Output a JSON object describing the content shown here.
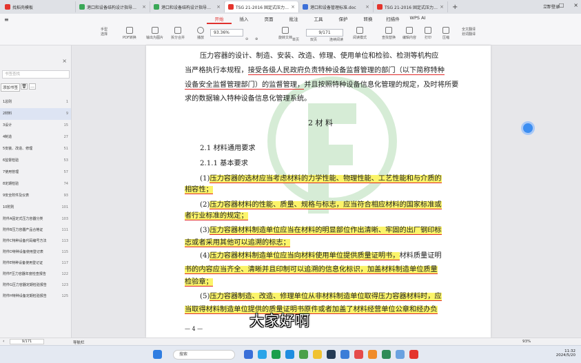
{
  "tabs": [
    {
      "title": "找稻壳模板",
      "color": "#e4352d"
    },
    {
      "title": "港口和设备结构设计指导书2020",
      "color": "#3aa857"
    },
    {
      "title": "港口和设备结构设计指导书2020",
      "color": "#3aa857"
    },
    {
      "title": "TSG 21-2016 固定式压力容器安全",
      "color": "#e4352d"
    },
    {
      "title": "港口和设备管理标准.doc",
      "color": "#3b6fd8"
    },
    {
      "title": "TSG 21-2016 固定式压力容器安全",
      "color": "#e4352d"
    }
  ],
  "login_label": "立即登录",
  "menus": [
    "开始",
    "插入",
    "页面",
    "批注",
    "工具",
    "保护",
    "转换",
    "扫描件",
    "WPS AI"
  ],
  "active_menu": "开始",
  "toolbar": {
    "hand": "手型",
    "select": "选择",
    "pdf_convert": "PDF转换",
    "pdf_to_img": "输出为图片",
    "split_merge": "拆分合并",
    "play": "播放",
    "zoom": "93.36%",
    "rotate": "旋转文档",
    "page": "9/171",
    "single": "单页",
    "double": "双页",
    "continuous": "连续阅读",
    "read_mode": "阅读模式",
    "find": "查找替换",
    "edit": "编辑内容",
    "print": "打印",
    "compress": "压缩",
    "full_translate": "全文翻译",
    "select_translate": "划词翻译"
  },
  "sidebar": {
    "search_placeholder": "书签查找",
    "add_label": "添加书签",
    "items": [
      {
        "label": "1总则",
        "page": "1"
      },
      {
        "label": "2材料",
        "page": "9"
      },
      {
        "label": "3设计",
        "page": "15"
      },
      {
        "label": "4制造",
        "page": "27"
      },
      {
        "label": "5安装、改造、修理",
        "page": "51"
      },
      {
        "label": "6监督检验",
        "page": "53"
      },
      {
        "label": "7使用管理",
        "page": "57"
      },
      {
        "label": "8定期检验",
        "page": "74"
      },
      {
        "label": "9安全附件及仪表",
        "page": "93"
      },
      {
        "label": "10附则",
        "page": "101"
      },
      {
        "label": "附件A固定式压力容器分类",
        "page": "103"
      },
      {
        "label": "附件B压力容器产品合格证",
        "page": "111"
      },
      {
        "label": "附件C特种设备代码编号方法",
        "page": "113"
      },
      {
        "label": "附件D特种设备使用登记表",
        "page": "115"
      },
      {
        "label": "附件E特种设备使用登记证",
        "page": "117"
      },
      {
        "label": "附件F压力容器年度检查报告",
        "page": "122"
      },
      {
        "label": "附件G压力容器定期检验报告",
        "page": "123"
      },
      {
        "label": "附件H特种设备定期检验报告",
        "page": "125"
      }
    ],
    "page_input": "9/171"
  },
  "doc": {
    "l1": "压力容器的设计、制造、安装、改造、修理、使用单位和检验、检测等机构应",
    "l2a": "当严格执行本规程，",
    "l2b": "接受各级人民政府负责特种设备监督管理的部门（以下简称特种",
    "l3a": "设备安全监督管理部门）的监督管理，",
    "l3b": "并且按照特种设备信息化管理的规定，及时将所要",
    "l4": "求的数据输入特种设备信息化管理系统。",
    "h2": "2  材    料",
    "s21": "2.1  材料通用要求",
    "s211": "2.1.1  基本要求",
    "p1a": "(1)",
    "p1b": "压力容器的选材应当考虑材料的力学性能、物理性能、工艺性能和与介质的",
    "p1c": "相容性；",
    "p2a": "(2)",
    "p2b": "压力容器材料的性能、质量、规格与标志，应当符合相应材料的国家标准或",
    "p2c": "者行业标准的规定；",
    "p3a": "(3)",
    "p3b": "压力容器材料制造单位应当在材料的明显部位作出清晰、牢固的出厂钢印标",
    "p3c": "志或者采用其他可以追溯的标志；",
    "p4a": "(4)",
    "p4b": "压力容器材料制造单位应当向材料使用单位提供质量证明书，",
    "p4c": "材料质量证明",
    "p4d": "书的内容应当齐全、清晰并且印制可以追溯的信息化标识，加盖材料制造单位质量",
    "p4e": "检验章；",
    "p5a": "(5)",
    "p5b": "压力容器制造、改造、修理单位从非材料制造单位取得压力容器材料时，应",
    "p5c": "当取得材料制造单位提供的质量证明书原件或者加盖了材料经营单位公章和经办负",
    "footer": "— 4 —"
  },
  "caption": "大家好啊",
  "status": {
    "nav": "导航栏",
    "zoom": "93%"
  },
  "taskbar": {
    "search": "搜索",
    "time": "11:32",
    "date": "2024/5/20"
  }
}
